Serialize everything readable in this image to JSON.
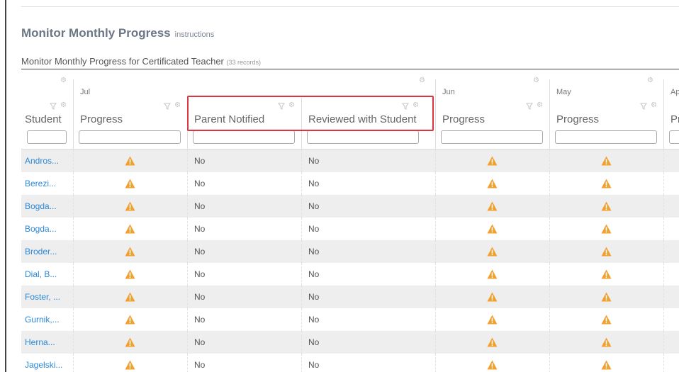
{
  "page": {
    "title": "Monitor Monthly Progress",
    "instructions_link": "instructions",
    "subtitle": "Monitor Monthly Progress for Certificated Teacher",
    "record_count": "(33 records)"
  },
  "grid": {
    "groups": [
      {
        "label": "Jul"
      },
      {
        "label": "Jun"
      },
      {
        "label": "May"
      },
      {
        "label": "Apr"
      }
    ],
    "columns": [
      {
        "label": "Student"
      },
      {
        "label": "Progress"
      },
      {
        "label": "Parent Notified"
      },
      {
        "label": "Reviewed with Student"
      },
      {
        "label": "Progress"
      },
      {
        "label": "Progress"
      },
      {
        "label": "Pro"
      }
    ],
    "rows": [
      {
        "student": "Andros...",
        "parent_notified": "No",
        "reviewed": "No"
      },
      {
        "student": "Berezi...",
        "parent_notified": "No",
        "reviewed": "No"
      },
      {
        "student": "Bogda...",
        "parent_notified": "No",
        "reviewed": "No"
      },
      {
        "student": "Bogda...",
        "parent_notified": "No",
        "reviewed": "No"
      },
      {
        "student": "Broder...",
        "parent_notified": "No",
        "reviewed": "No"
      },
      {
        "student": "Dial, B...",
        "parent_notified": "No",
        "reviewed": "No"
      },
      {
        "student": "Foster, ...",
        "parent_notified": "No",
        "reviewed": "No"
      },
      {
        "student": "Gurnik,...",
        "parent_notified": "No",
        "reviewed": "No"
      },
      {
        "student": "Herna...",
        "parent_notified": "No",
        "reviewed": "No"
      },
      {
        "student": "Jagelski...",
        "parent_notified": "No",
        "reviewed": "No"
      }
    ]
  },
  "icons": {
    "warning": "warning-triangle-icon",
    "filter": "filter-icon",
    "settings": "gear-icon"
  },
  "colors": {
    "link": "#2a88d8",
    "warning": "#f0a030",
    "highlight": "#d9363e",
    "row_alt": "#eeeeee"
  }
}
